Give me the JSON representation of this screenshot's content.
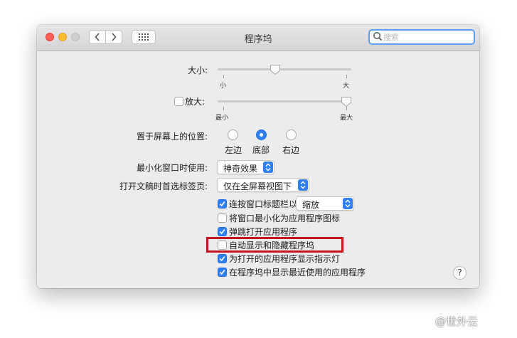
{
  "window": {
    "title": "程序坞",
    "search_placeholder": "搜索",
    "search_value": ""
  },
  "size": {
    "label": "大小:",
    "min_label": "小",
    "max_label": "大",
    "value_percent": 42
  },
  "magnification": {
    "label": "放大:",
    "checked": false,
    "min_label": "最小",
    "max_label": "最大",
    "value_percent": 100
  },
  "position": {
    "label": "置于屏幕上的位置:",
    "options": [
      {
        "label": "左边",
        "selected": false
      },
      {
        "label": "底部",
        "selected": true
      },
      {
        "label": "右边",
        "selected": false
      }
    ]
  },
  "minimize": {
    "label": "最小化窗口时使用:",
    "value": "神奇效果"
  },
  "tabs_pref": {
    "label": "打开文稿时首选标签页:",
    "value": "仅在全屏幕视图下"
  },
  "double_click": {
    "label": "连按窗口标题栏以",
    "checked": true,
    "value": "缩放"
  },
  "checkboxes": [
    {
      "label": "将窗口最小化为应用程序图标",
      "checked": false
    },
    {
      "label": "弹跳打开应用程序",
      "checked": true
    },
    {
      "label": "自动显示和隐藏程序坞",
      "checked": false
    },
    {
      "label": "为打开的应用程序显示指示灯",
      "checked": true
    },
    {
      "label": "在程序坞中显示最近使用的应用程序",
      "checked": true
    }
  ],
  "help_label": "?",
  "watermark": "@世外云",
  "colors": {
    "accent": "#2f7ff6",
    "highlight_box": "#c4161c"
  }
}
